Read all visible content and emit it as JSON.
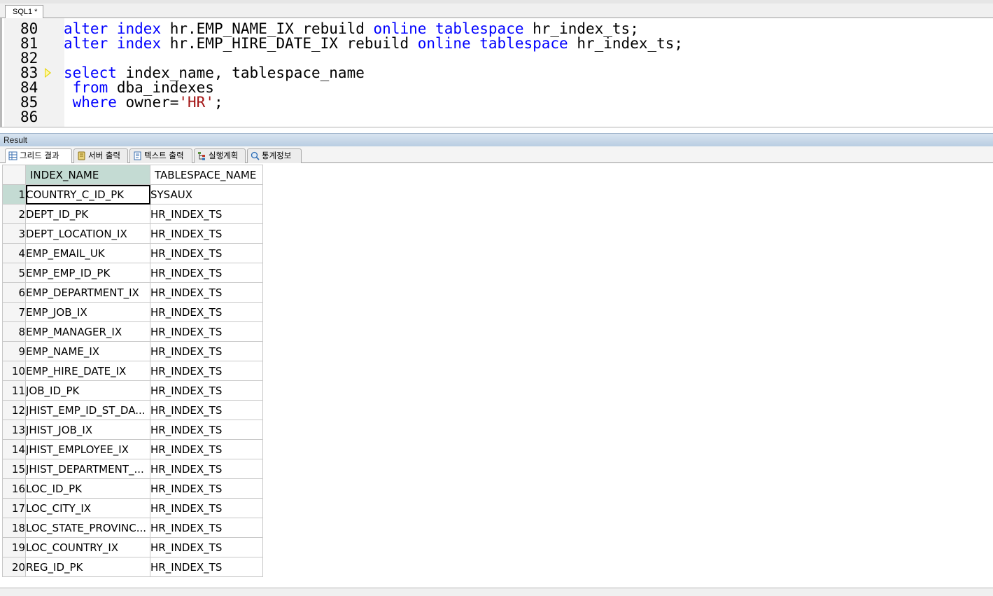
{
  "editor_tab": {
    "label": "SQL1 *"
  },
  "code_lines": [
    {
      "n": "80",
      "tokens": [
        {
          "t": "alter",
          "k": "kw"
        },
        {
          "t": " "
        },
        {
          "t": "index",
          "k": "kw"
        },
        {
          "t": " hr.EMP_NAME_IX rebuild "
        },
        {
          "t": "online",
          "k": "kw"
        },
        {
          "t": " "
        },
        {
          "t": "tablespace",
          "k": "kw"
        },
        {
          "t": " hr_index_ts;"
        }
      ]
    },
    {
      "n": "81",
      "tokens": [
        {
          "t": "alter",
          "k": "kw"
        },
        {
          "t": " "
        },
        {
          "t": "index",
          "k": "kw"
        },
        {
          "t": " hr.EMP_HIRE_DATE_IX rebuild "
        },
        {
          "t": "online",
          "k": "kw"
        },
        {
          "t": " "
        },
        {
          "t": "tablespace",
          "k": "kw"
        },
        {
          "t": " hr_index_ts;"
        }
      ]
    },
    {
      "n": "82",
      "tokens": []
    },
    {
      "n": "83",
      "marker": true,
      "tokens": [
        {
          "t": "select",
          "k": "kw"
        },
        {
          "t": " index_name, tablespace_name"
        }
      ]
    },
    {
      "n": "84",
      "tokens": [
        {
          "t": " "
        },
        {
          "t": "from",
          "k": "kw"
        },
        {
          "t": " dba_indexes"
        }
      ]
    },
    {
      "n": "85",
      "tokens": [
        {
          "t": " "
        },
        {
          "t": "where",
          "k": "kw"
        },
        {
          "t": " owner="
        },
        {
          "t": "'HR'",
          "k": "str"
        },
        {
          "t": ";"
        }
      ]
    },
    {
      "n": "86",
      "tokens": []
    }
  ],
  "result": {
    "title": "Result",
    "tabs": [
      {
        "label": "그리드 결과",
        "icon": "grid-icon",
        "active": true
      },
      {
        "label": "서버 출력",
        "icon": "server-output-icon"
      },
      {
        "label": "텍스트 출력",
        "icon": "text-output-icon"
      },
      {
        "label": "실행계획",
        "icon": "execution-plan-icon"
      },
      {
        "label": "통계정보",
        "icon": "statistics-icon"
      }
    ],
    "columns": [
      "INDEX_NAME",
      "TABLESPACE_NAME"
    ],
    "rows": [
      [
        "1",
        "COUNTRY_C_ID_PK",
        "SYSAUX"
      ],
      [
        "2",
        "DEPT_ID_PK",
        "HR_INDEX_TS"
      ],
      [
        "3",
        "DEPT_LOCATION_IX",
        "HR_INDEX_TS"
      ],
      [
        "4",
        "EMP_EMAIL_UK",
        "HR_INDEX_TS"
      ],
      [
        "5",
        "EMP_EMP_ID_PK",
        "HR_INDEX_TS"
      ],
      [
        "6",
        "EMP_DEPARTMENT_IX",
        "HR_INDEX_TS"
      ],
      [
        "7",
        "EMP_JOB_IX",
        "HR_INDEX_TS"
      ],
      [
        "8",
        "EMP_MANAGER_IX",
        "HR_INDEX_TS"
      ],
      [
        "9",
        "EMP_NAME_IX",
        "HR_INDEX_TS"
      ],
      [
        "10",
        "EMP_HIRE_DATE_IX",
        "HR_INDEX_TS"
      ],
      [
        "11",
        "JOB_ID_PK",
        "HR_INDEX_TS"
      ],
      [
        "12",
        "JHIST_EMP_ID_ST_DA...",
        "HR_INDEX_TS"
      ],
      [
        "13",
        "JHIST_JOB_IX",
        "HR_INDEX_TS"
      ],
      [
        "14",
        "JHIST_EMPLOYEE_IX",
        "HR_INDEX_TS"
      ],
      [
        "15",
        "JHIST_DEPARTMENT_...",
        "HR_INDEX_TS"
      ],
      [
        "16",
        "LOC_ID_PK",
        "HR_INDEX_TS"
      ],
      [
        "17",
        "LOC_CITY_IX",
        "HR_INDEX_TS"
      ],
      [
        "18",
        "LOC_STATE_PROVINC...",
        "HR_INDEX_TS"
      ],
      [
        "19",
        "LOC_COUNTRY_IX",
        "HR_INDEX_TS"
      ],
      [
        "20",
        "REG_ID_PK",
        "HR_INDEX_TS"
      ]
    ]
  }
}
